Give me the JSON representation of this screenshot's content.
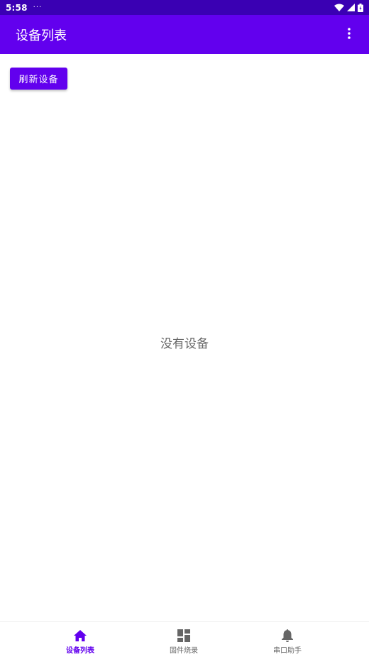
{
  "status_bar": {
    "time": "5:58",
    "notification_dots": "···",
    "icons": [
      "wifi-icon",
      "cell-signal-icon",
      "battery-icon"
    ]
  },
  "app_bar": {
    "title": "设备列表",
    "overflow_icon": "more-vert-icon"
  },
  "main": {
    "refresh_button_label": "刷新设备",
    "empty_message": "没有设备"
  },
  "bottom_nav": {
    "items": [
      {
        "label": "设备列表",
        "icon": "home-icon",
        "active": true
      },
      {
        "label": "固件烧录",
        "icon": "dashboard-icon",
        "active": false
      },
      {
        "label": "串口助手",
        "icon": "bell-icon",
        "active": false
      }
    ]
  },
  "colors": {
    "primary": "#6200ee",
    "primary_dark": "#3a00b3",
    "inactive": "#666666",
    "background": "#ffffff"
  }
}
